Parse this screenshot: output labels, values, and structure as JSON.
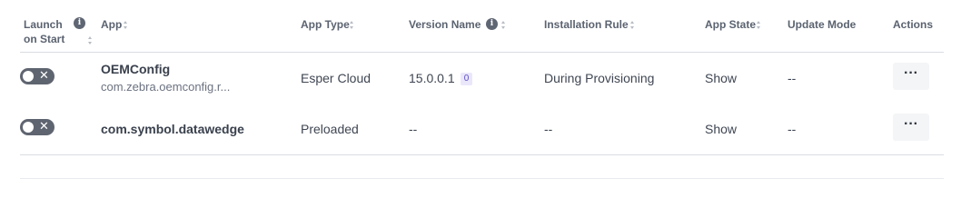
{
  "headers": {
    "launch_line1": "Launch",
    "launch_line2": "on Start",
    "info_glyph": "i",
    "app": "App",
    "app_type": "App Type",
    "version_name": "Version Name",
    "installation_rule": "Installation Rule",
    "app_state": "App State",
    "update_mode": "Update Mode",
    "actions": "Actions"
  },
  "rows": [
    {
      "toggle_x": "✕",
      "app_name": "OEMConfig",
      "package": "com.zebra.oemconfig.r...",
      "app_type": "Esper Cloud",
      "version": "15.0.0.1",
      "version_badge": "0",
      "installation_rule": "During Provisioning",
      "app_state": "Show",
      "update_mode": "--",
      "actions": "···"
    },
    {
      "toggle_x": "✕",
      "app_name": "com.symbol.datawedge",
      "app_type": "Preloaded",
      "version": "--",
      "installation_rule": "--",
      "app_state": "Show",
      "update_mode": "--",
      "actions": "···"
    }
  ],
  "icons": {
    "info": "info-icon",
    "sort": "sort-icon",
    "toggle": "toggle-switch",
    "more": "more-horizontal-icon"
  }
}
